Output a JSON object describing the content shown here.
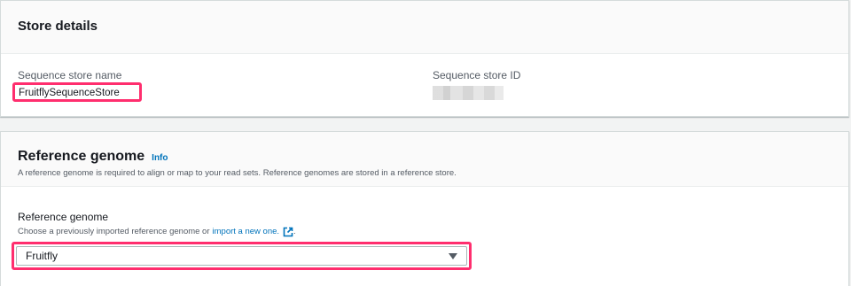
{
  "store_details": {
    "title": "Store details",
    "name_label": "Sequence store name",
    "name_value": "FruitflySequenceStore",
    "id_label": "Sequence store ID"
  },
  "reference_genome": {
    "title": "Reference genome",
    "info_link": "Info",
    "description": "A reference genome is required to align or map to your read sets. Reference genomes are stored in a reference store.",
    "field_label": "Reference genome",
    "hint_prefix": "Choose a previously imported reference genome or",
    "hint_link": "import a new one.",
    "hint_suffix": ".",
    "selected_value": "Fruitfly"
  },
  "icons": {
    "external_link": "external-link-icon",
    "dropdown": "caret-down-icon"
  },
  "colors": {
    "highlight": "#ff2e6e",
    "link": "#0073bb"
  }
}
